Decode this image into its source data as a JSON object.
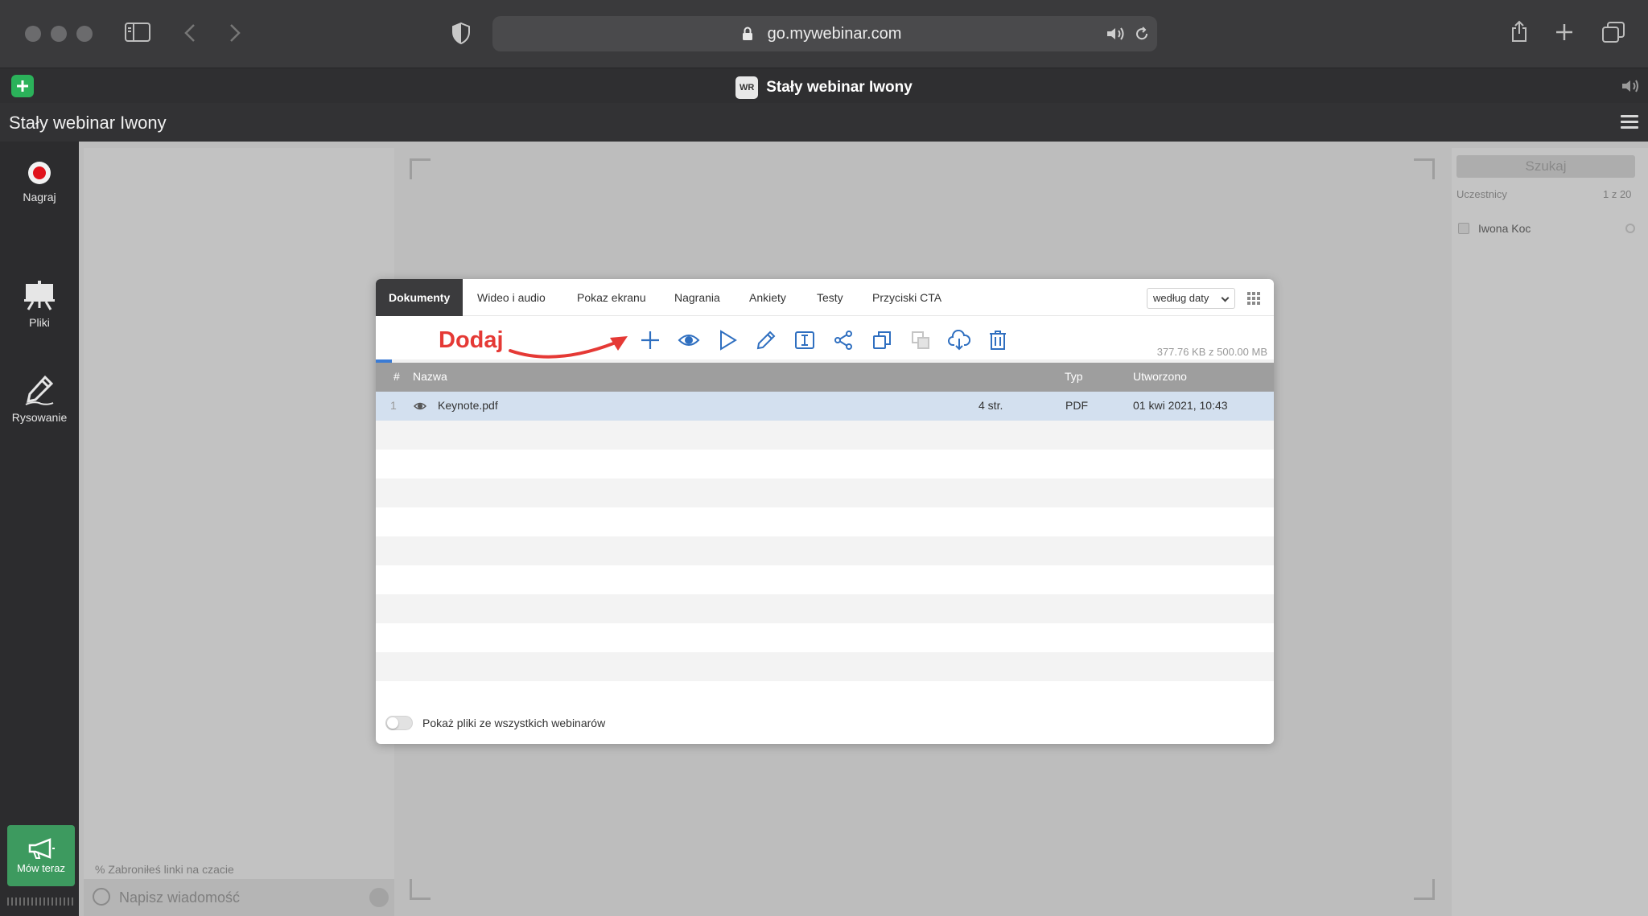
{
  "browser": {
    "url": "go.mywebinar.com",
    "tab_title": "Stały webinar Iwony",
    "favicon_text": "WR"
  },
  "app": {
    "title": "Stały webinar Iwony"
  },
  "tools": [
    {
      "label": "Nagraj",
      "icon": "record-icon"
    },
    {
      "label": "Pliki",
      "icon": "easel-icon"
    },
    {
      "label": "Rysowanie",
      "icon": "pencil-icon"
    }
  ],
  "speak": {
    "label": "Mów teraz"
  },
  "chat": {
    "notice": "Zabroniłeś linki na czacie",
    "placeholder": "Napisz wiadomość"
  },
  "participants": {
    "search_label": "Szukaj",
    "heading": "Uczestnicy",
    "count": "1 z 20",
    "list": [
      {
        "name": "Iwona Koc"
      }
    ]
  },
  "modal": {
    "tabs": [
      "Dokumenty",
      "Wideo i audio",
      "Pokaz ekranu",
      "Nagrania",
      "Ankiety",
      "Testy",
      "Przyciski CTA"
    ],
    "active_tab": "Dokumenty",
    "sort": "według daty",
    "annotation": "Dodaj",
    "storage": "377.76 KB z 500.00 MB",
    "storage_used_fraction": 0.0007,
    "columns": {
      "num": "#",
      "name": "Nazwa",
      "type": "Typ",
      "created": "Utworzono"
    },
    "files": [
      {
        "num": "1",
        "name": "Keynote.pdf",
        "pages": "4 str.",
        "type": "PDF",
        "created": "01 kwi 2021, 10:43"
      }
    ],
    "toggle_label": "Pokaż pliki ze wszystkich webinarów"
  },
  "colors": {
    "accent": "#3a7bd5",
    "annotation": "#e53935",
    "speak": "#3d9a5f",
    "record": "#e0121b"
  }
}
